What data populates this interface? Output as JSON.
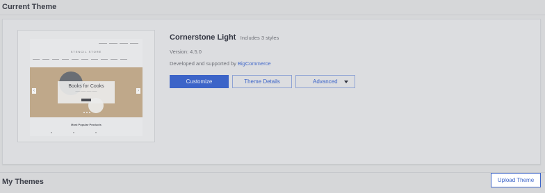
{
  "current_theme": {
    "section_title": "Current Theme",
    "theme_name": "Cornerstone Light",
    "styles_note": "Includes 3 styles",
    "version_label": "Version: 4.5.0",
    "developer_prefix": "Developed and supported by",
    "developer_link": "BigCommerce",
    "buttons": {
      "customize": "Customize",
      "theme_details": "Theme Details",
      "advanced": "Advanced"
    },
    "preview": {
      "store_name": "STENCIL STORE",
      "hero_title": "Books for Cooks",
      "section_heading": "Most Popular Products"
    }
  },
  "my_themes": {
    "section_title": "My Themes",
    "upload_button": "Upload Theme"
  },
  "colors": {
    "accent": "#3c64c8",
    "page_background": "#d6d7d9"
  },
  "icons": {
    "advanced_caret": "caret-down-icon",
    "preview_prev": "chevron-left-icon",
    "preview_next": "chevron-right-icon"
  }
}
